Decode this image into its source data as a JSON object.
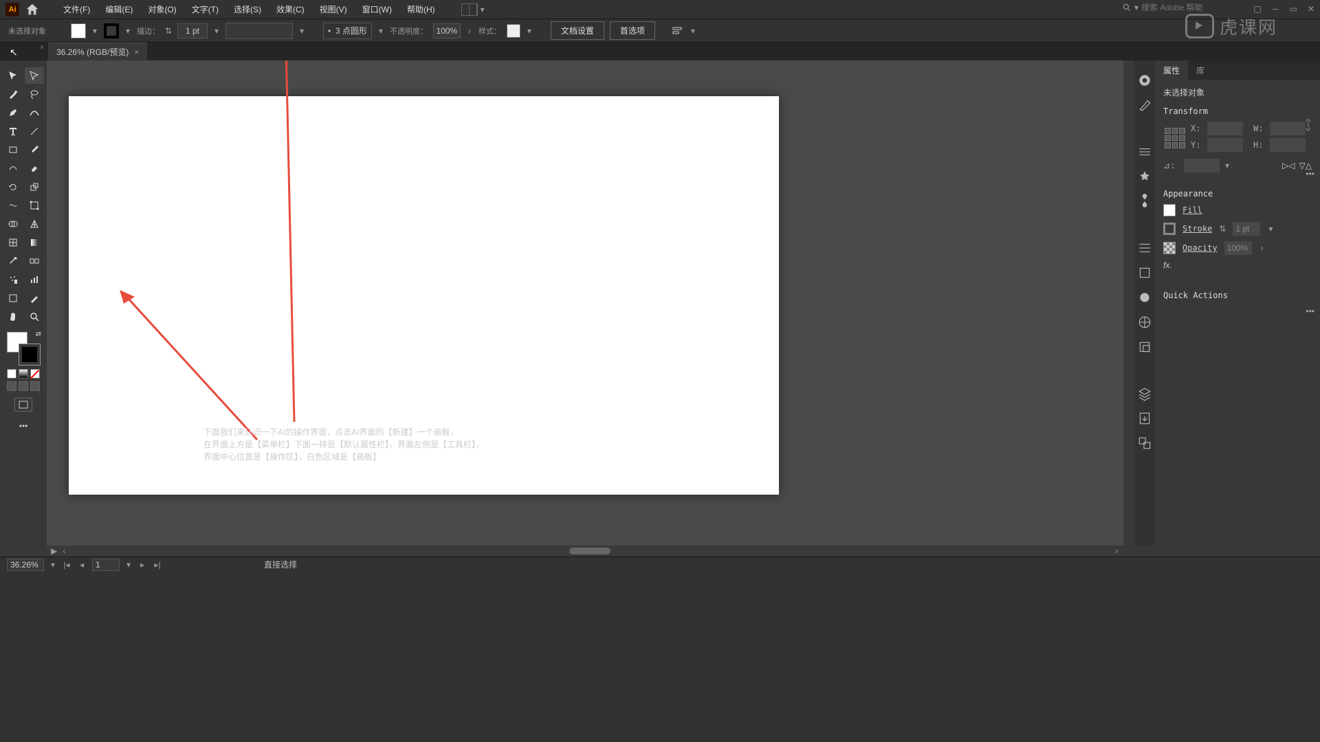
{
  "menubar": {
    "items": [
      "文件(F)",
      "编辑(E)",
      "对象(O)",
      "文字(T)",
      "选择(S)",
      "效果(C)",
      "视图(V)",
      "窗口(W)",
      "帮助(H)"
    ]
  },
  "search": {
    "placeholder": "搜索 Adobe 帮助"
  },
  "optbar": {
    "noSelection": "未选择对象",
    "strokeLabel": "描边：",
    "strokeVal": "1 pt",
    "dashLabel": "3 点圆形",
    "opacityLabel": "不透明度：",
    "opacityVal": "100%",
    "styleLabel": "样式：",
    "docSetup": "文档设置",
    "prefs": "首选项"
  },
  "tab": {
    "title": "36.26% (RGB/预览)"
  },
  "annotation": {
    "line1": "下面我们来认识一下AI的操作界面，点击AI界面的【新建】一个画板，",
    "line2": "在界面上方是【菜单栏】下面一排是【默认属性栏】，界面左侧是【工具栏】，",
    "line3": "界面中心位置是【操作区】，白色区域是【画板】"
  },
  "props": {
    "tabs": [
      "属性",
      "库"
    ],
    "noSel": "未选择对象",
    "transform": "Transform",
    "x": "X:",
    "y": "Y:",
    "w": "W:",
    "h": "H:",
    "angle": "⊿:",
    "appearance": "Appearance",
    "fill": "Fill",
    "stroke": "Stroke",
    "strokeVal": "1 pt",
    "opacity": "Opacity",
    "opacityVal": "100%",
    "fx": "fx.",
    "quick": "Quick Actions"
  },
  "status": {
    "zoom": "36.26%",
    "artboard": "1",
    "tool": "直接选择"
  },
  "watermark": "虎课网"
}
